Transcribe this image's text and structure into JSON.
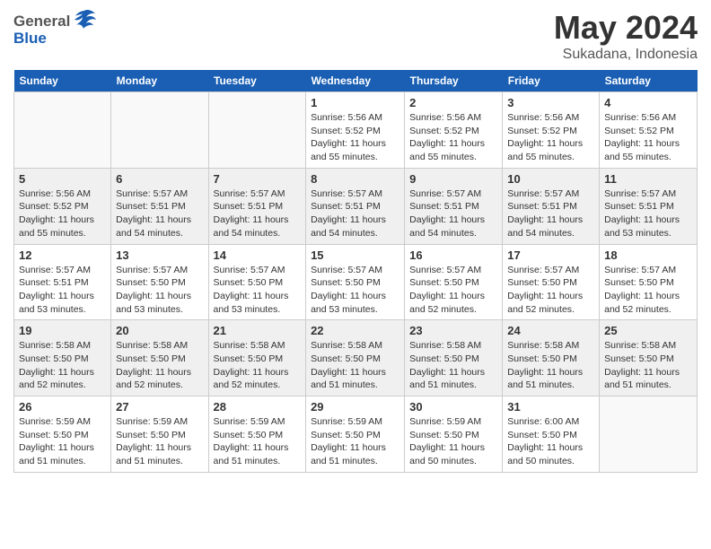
{
  "logo": {
    "general": "General",
    "blue": "Blue"
  },
  "title": "May 2024",
  "subtitle": "Sukadana, Indonesia",
  "headers": [
    "Sunday",
    "Monday",
    "Tuesday",
    "Wednesday",
    "Thursday",
    "Friday",
    "Saturday"
  ],
  "weeks": [
    [
      {
        "day": "",
        "text": ""
      },
      {
        "day": "",
        "text": ""
      },
      {
        "day": "",
        "text": ""
      },
      {
        "day": "1",
        "text": "Sunrise: 5:56 AM\nSunset: 5:52 PM\nDaylight: 11 hours and 55 minutes."
      },
      {
        "day": "2",
        "text": "Sunrise: 5:56 AM\nSunset: 5:52 PM\nDaylight: 11 hours and 55 minutes."
      },
      {
        "day": "3",
        "text": "Sunrise: 5:56 AM\nSunset: 5:52 PM\nDaylight: 11 hours and 55 minutes."
      },
      {
        "day": "4",
        "text": "Sunrise: 5:56 AM\nSunset: 5:52 PM\nDaylight: 11 hours and 55 minutes."
      }
    ],
    [
      {
        "day": "5",
        "text": "Sunrise: 5:56 AM\nSunset: 5:52 PM\nDaylight: 11 hours and 55 minutes."
      },
      {
        "day": "6",
        "text": "Sunrise: 5:57 AM\nSunset: 5:51 PM\nDaylight: 11 hours and 54 minutes."
      },
      {
        "day": "7",
        "text": "Sunrise: 5:57 AM\nSunset: 5:51 PM\nDaylight: 11 hours and 54 minutes."
      },
      {
        "day": "8",
        "text": "Sunrise: 5:57 AM\nSunset: 5:51 PM\nDaylight: 11 hours and 54 minutes."
      },
      {
        "day": "9",
        "text": "Sunrise: 5:57 AM\nSunset: 5:51 PM\nDaylight: 11 hours and 54 minutes."
      },
      {
        "day": "10",
        "text": "Sunrise: 5:57 AM\nSunset: 5:51 PM\nDaylight: 11 hours and 54 minutes."
      },
      {
        "day": "11",
        "text": "Sunrise: 5:57 AM\nSunset: 5:51 PM\nDaylight: 11 hours and 53 minutes."
      }
    ],
    [
      {
        "day": "12",
        "text": "Sunrise: 5:57 AM\nSunset: 5:51 PM\nDaylight: 11 hours and 53 minutes."
      },
      {
        "day": "13",
        "text": "Sunrise: 5:57 AM\nSunset: 5:50 PM\nDaylight: 11 hours and 53 minutes."
      },
      {
        "day": "14",
        "text": "Sunrise: 5:57 AM\nSunset: 5:50 PM\nDaylight: 11 hours and 53 minutes."
      },
      {
        "day": "15",
        "text": "Sunrise: 5:57 AM\nSunset: 5:50 PM\nDaylight: 11 hours and 53 minutes."
      },
      {
        "day": "16",
        "text": "Sunrise: 5:57 AM\nSunset: 5:50 PM\nDaylight: 11 hours and 52 minutes."
      },
      {
        "day": "17",
        "text": "Sunrise: 5:57 AM\nSunset: 5:50 PM\nDaylight: 11 hours and 52 minutes."
      },
      {
        "day": "18",
        "text": "Sunrise: 5:57 AM\nSunset: 5:50 PM\nDaylight: 11 hours and 52 minutes."
      }
    ],
    [
      {
        "day": "19",
        "text": "Sunrise: 5:58 AM\nSunset: 5:50 PM\nDaylight: 11 hours and 52 minutes."
      },
      {
        "day": "20",
        "text": "Sunrise: 5:58 AM\nSunset: 5:50 PM\nDaylight: 11 hours and 52 minutes."
      },
      {
        "day": "21",
        "text": "Sunrise: 5:58 AM\nSunset: 5:50 PM\nDaylight: 11 hours and 52 minutes."
      },
      {
        "day": "22",
        "text": "Sunrise: 5:58 AM\nSunset: 5:50 PM\nDaylight: 11 hours and 51 minutes."
      },
      {
        "day": "23",
        "text": "Sunrise: 5:58 AM\nSunset: 5:50 PM\nDaylight: 11 hours and 51 minutes."
      },
      {
        "day": "24",
        "text": "Sunrise: 5:58 AM\nSunset: 5:50 PM\nDaylight: 11 hours and 51 minutes."
      },
      {
        "day": "25",
        "text": "Sunrise: 5:58 AM\nSunset: 5:50 PM\nDaylight: 11 hours and 51 minutes."
      }
    ],
    [
      {
        "day": "26",
        "text": "Sunrise: 5:59 AM\nSunset: 5:50 PM\nDaylight: 11 hours and 51 minutes."
      },
      {
        "day": "27",
        "text": "Sunrise: 5:59 AM\nSunset: 5:50 PM\nDaylight: 11 hours and 51 minutes."
      },
      {
        "day": "28",
        "text": "Sunrise: 5:59 AM\nSunset: 5:50 PM\nDaylight: 11 hours and 51 minutes."
      },
      {
        "day": "29",
        "text": "Sunrise: 5:59 AM\nSunset: 5:50 PM\nDaylight: 11 hours and 51 minutes."
      },
      {
        "day": "30",
        "text": "Sunrise: 5:59 AM\nSunset: 5:50 PM\nDaylight: 11 hours and 50 minutes."
      },
      {
        "day": "31",
        "text": "Sunrise: 6:00 AM\nSunset: 5:50 PM\nDaylight: 11 hours and 50 minutes."
      },
      {
        "day": "",
        "text": ""
      }
    ]
  ]
}
